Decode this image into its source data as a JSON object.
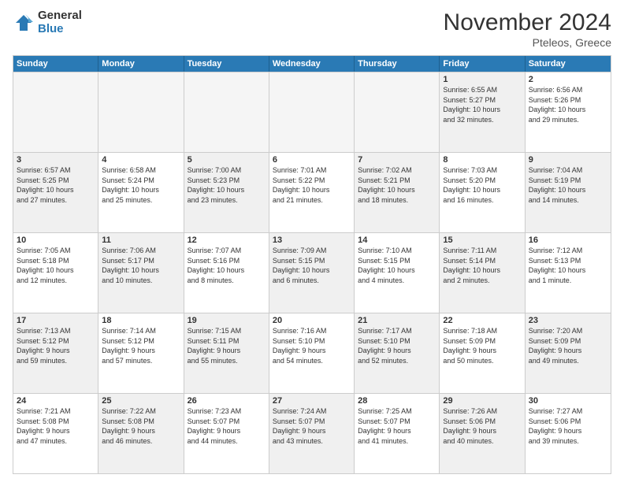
{
  "logo": {
    "general": "General",
    "blue": "Blue"
  },
  "header": {
    "month": "November 2024",
    "location": "Pteleos, Greece"
  },
  "weekdays": [
    "Sunday",
    "Monday",
    "Tuesday",
    "Wednesday",
    "Thursday",
    "Friday",
    "Saturday"
  ],
  "rows": [
    [
      {
        "num": "",
        "info": "",
        "empty": true
      },
      {
        "num": "",
        "info": "",
        "empty": true
      },
      {
        "num": "",
        "info": "",
        "empty": true
      },
      {
        "num": "",
        "info": "",
        "empty": true
      },
      {
        "num": "",
        "info": "",
        "empty": true
      },
      {
        "num": "1",
        "info": "Sunrise: 6:55 AM\nSunset: 5:27 PM\nDaylight: 10 hours\nand 32 minutes.",
        "shaded": true
      },
      {
        "num": "2",
        "info": "Sunrise: 6:56 AM\nSunset: 5:26 PM\nDaylight: 10 hours\nand 29 minutes.",
        "shaded": false
      }
    ],
    [
      {
        "num": "3",
        "info": "Sunrise: 6:57 AM\nSunset: 5:25 PM\nDaylight: 10 hours\nand 27 minutes.",
        "shaded": true
      },
      {
        "num": "4",
        "info": "Sunrise: 6:58 AM\nSunset: 5:24 PM\nDaylight: 10 hours\nand 25 minutes.",
        "shaded": false
      },
      {
        "num": "5",
        "info": "Sunrise: 7:00 AM\nSunset: 5:23 PM\nDaylight: 10 hours\nand 23 minutes.",
        "shaded": true
      },
      {
        "num": "6",
        "info": "Sunrise: 7:01 AM\nSunset: 5:22 PM\nDaylight: 10 hours\nand 21 minutes.",
        "shaded": false
      },
      {
        "num": "7",
        "info": "Sunrise: 7:02 AM\nSunset: 5:21 PM\nDaylight: 10 hours\nand 18 minutes.",
        "shaded": true
      },
      {
        "num": "8",
        "info": "Sunrise: 7:03 AM\nSunset: 5:20 PM\nDaylight: 10 hours\nand 16 minutes.",
        "shaded": false
      },
      {
        "num": "9",
        "info": "Sunrise: 7:04 AM\nSunset: 5:19 PM\nDaylight: 10 hours\nand 14 minutes.",
        "shaded": true
      }
    ],
    [
      {
        "num": "10",
        "info": "Sunrise: 7:05 AM\nSunset: 5:18 PM\nDaylight: 10 hours\nand 12 minutes.",
        "shaded": false
      },
      {
        "num": "11",
        "info": "Sunrise: 7:06 AM\nSunset: 5:17 PM\nDaylight: 10 hours\nand 10 minutes.",
        "shaded": true
      },
      {
        "num": "12",
        "info": "Sunrise: 7:07 AM\nSunset: 5:16 PM\nDaylight: 10 hours\nand 8 minutes.",
        "shaded": false
      },
      {
        "num": "13",
        "info": "Sunrise: 7:09 AM\nSunset: 5:15 PM\nDaylight: 10 hours\nand 6 minutes.",
        "shaded": true
      },
      {
        "num": "14",
        "info": "Sunrise: 7:10 AM\nSunset: 5:15 PM\nDaylight: 10 hours\nand 4 minutes.",
        "shaded": false
      },
      {
        "num": "15",
        "info": "Sunrise: 7:11 AM\nSunset: 5:14 PM\nDaylight: 10 hours\nand 2 minutes.",
        "shaded": true
      },
      {
        "num": "16",
        "info": "Sunrise: 7:12 AM\nSunset: 5:13 PM\nDaylight: 10 hours\nand 1 minute.",
        "shaded": false
      }
    ],
    [
      {
        "num": "17",
        "info": "Sunrise: 7:13 AM\nSunset: 5:12 PM\nDaylight: 9 hours\nand 59 minutes.",
        "shaded": true
      },
      {
        "num": "18",
        "info": "Sunrise: 7:14 AM\nSunset: 5:12 PM\nDaylight: 9 hours\nand 57 minutes.",
        "shaded": false
      },
      {
        "num": "19",
        "info": "Sunrise: 7:15 AM\nSunset: 5:11 PM\nDaylight: 9 hours\nand 55 minutes.",
        "shaded": true
      },
      {
        "num": "20",
        "info": "Sunrise: 7:16 AM\nSunset: 5:10 PM\nDaylight: 9 hours\nand 54 minutes.",
        "shaded": false
      },
      {
        "num": "21",
        "info": "Sunrise: 7:17 AM\nSunset: 5:10 PM\nDaylight: 9 hours\nand 52 minutes.",
        "shaded": true
      },
      {
        "num": "22",
        "info": "Sunrise: 7:18 AM\nSunset: 5:09 PM\nDaylight: 9 hours\nand 50 minutes.",
        "shaded": false
      },
      {
        "num": "23",
        "info": "Sunrise: 7:20 AM\nSunset: 5:09 PM\nDaylight: 9 hours\nand 49 minutes.",
        "shaded": true
      }
    ],
    [
      {
        "num": "24",
        "info": "Sunrise: 7:21 AM\nSunset: 5:08 PM\nDaylight: 9 hours\nand 47 minutes.",
        "shaded": false
      },
      {
        "num": "25",
        "info": "Sunrise: 7:22 AM\nSunset: 5:08 PM\nDaylight: 9 hours\nand 46 minutes.",
        "shaded": true
      },
      {
        "num": "26",
        "info": "Sunrise: 7:23 AM\nSunset: 5:07 PM\nDaylight: 9 hours\nand 44 minutes.",
        "shaded": false
      },
      {
        "num": "27",
        "info": "Sunrise: 7:24 AM\nSunset: 5:07 PM\nDaylight: 9 hours\nand 43 minutes.",
        "shaded": true
      },
      {
        "num": "28",
        "info": "Sunrise: 7:25 AM\nSunset: 5:07 PM\nDaylight: 9 hours\nand 41 minutes.",
        "shaded": false
      },
      {
        "num": "29",
        "info": "Sunrise: 7:26 AM\nSunset: 5:06 PM\nDaylight: 9 hours\nand 40 minutes.",
        "shaded": true
      },
      {
        "num": "30",
        "info": "Sunrise: 7:27 AM\nSunset: 5:06 PM\nDaylight: 9 hours\nand 39 minutes.",
        "shaded": false
      }
    ]
  ]
}
